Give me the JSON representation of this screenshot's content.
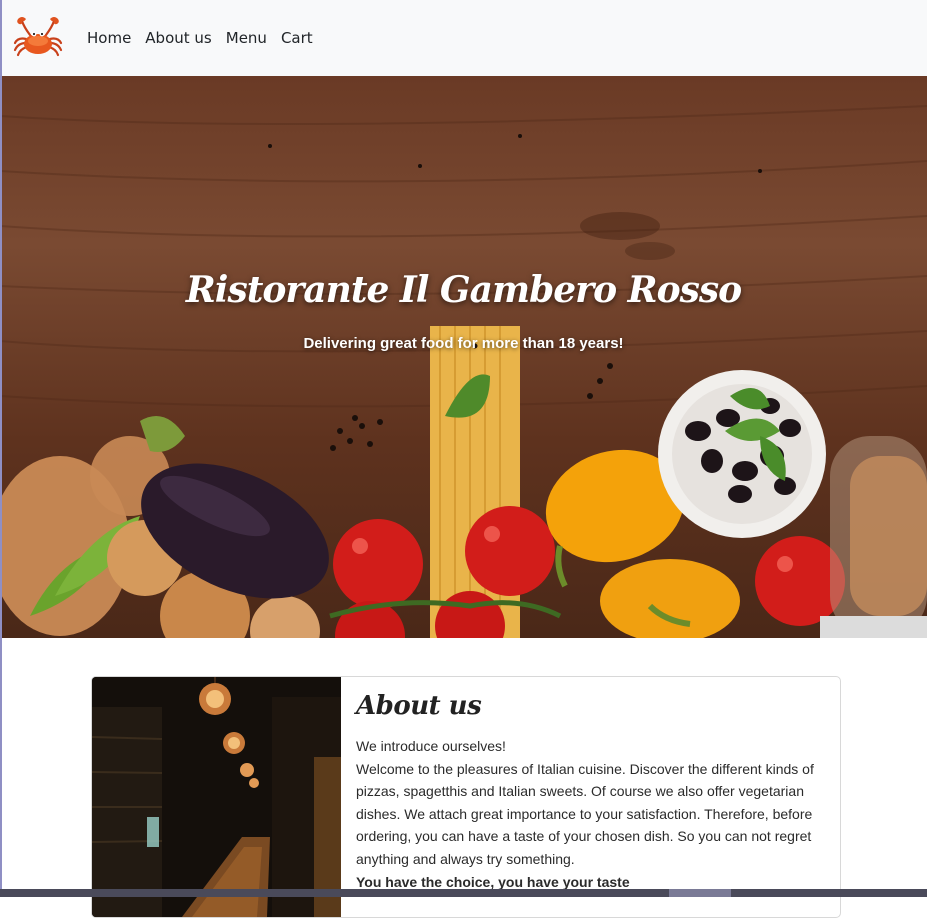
{
  "nav": {
    "logo_icon": "crab-icon",
    "links": [
      "Home",
      "About us",
      "Menu",
      "Cart"
    ]
  },
  "hero": {
    "title": "Ristorante Il Gambero Rosso",
    "subtitle": "Delivering great food for more than 18 years!"
  },
  "about": {
    "title": "About us",
    "lines": [
      "We introduce ourselves!",
      "Welcome to the pleasures of Italian cuisine. Discover the different kinds of pizzas, spagetthis and Italian sweets. Of course we also offer vegetarian dishes. We attach great importance to your satisfaction. Therefore, before ordering, you can have a taste of your chosen dish. So you can not regret anything and always try something.",
      "You have the choice, you have your taste"
    ]
  },
  "colors": {
    "navbar_bg": "#f8f9fa",
    "hero_wood": "#6a3a25",
    "text": "#212529"
  }
}
